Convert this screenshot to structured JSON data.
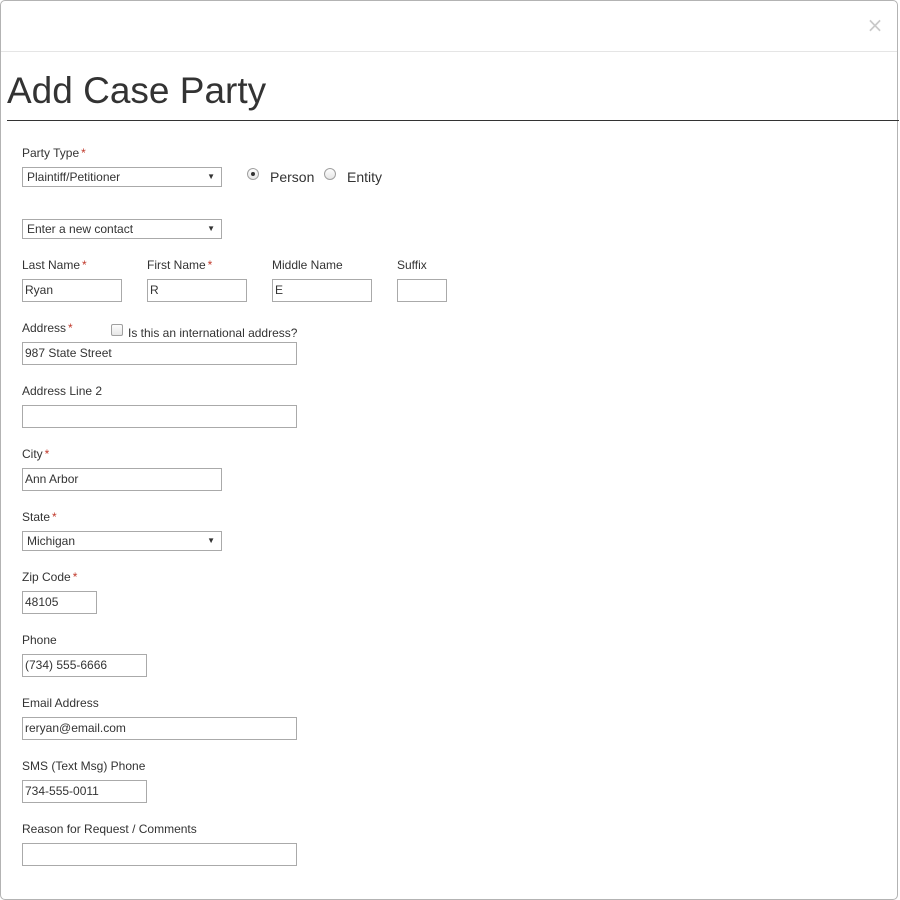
{
  "modal": {
    "close_glyph": "×",
    "title": "Add Case Party"
  },
  "form": {
    "required_mark": "*",
    "party_type": {
      "label": "Party Type",
      "value": "Plaintiff/Petitioner",
      "options": [
        {
          "label": "Person",
          "selected": true
        },
        {
          "label": "Entity",
          "selected": false
        }
      ]
    },
    "contact": {
      "value": "Enter a new contact"
    },
    "last_name": {
      "label": "Last Name",
      "value": "Ryan"
    },
    "first_name": {
      "label": "First Name",
      "value": "R"
    },
    "middle_name": {
      "label": "Middle Name",
      "value": "E"
    },
    "suffix": {
      "label": "Suffix",
      "value": ""
    },
    "address": {
      "label": "Address",
      "value": "987 State Street",
      "international_label": "Is this an international address?",
      "international_checked": false
    },
    "address2": {
      "label": "Address Line 2",
      "value": ""
    },
    "city": {
      "label": "City",
      "value": "Ann Arbor"
    },
    "state": {
      "label": "State",
      "value": "Michigan"
    },
    "zip": {
      "label": "Zip Code",
      "value": "48105"
    },
    "phone": {
      "label": "Phone",
      "value": "(734) 555-6666"
    },
    "email": {
      "label": "Email Address",
      "value": "reryan@email.com"
    },
    "sms": {
      "label": "SMS (Text Msg) Phone",
      "value": "734-555-0011"
    },
    "comments": {
      "label": "Reason for Request / Comments",
      "value": ""
    }
  }
}
